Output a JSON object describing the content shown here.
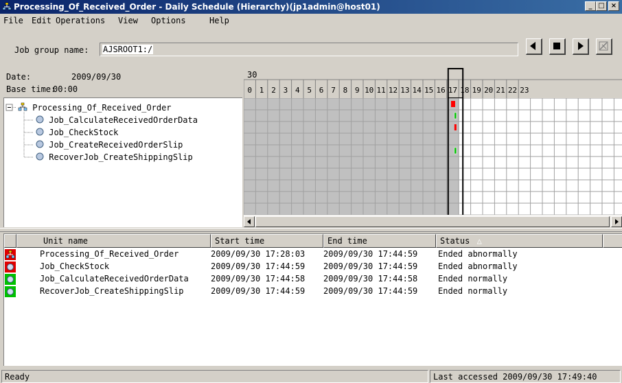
{
  "window": {
    "title": "Processing_Of_Received_Order - Daily Schedule (Hierarchy)(jp1admin@host01)",
    "caption_buttons": [
      "_",
      "□",
      "×"
    ]
  },
  "menu": [
    "File",
    "Edit",
    "Operations",
    "View",
    "Options",
    "Help"
  ],
  "toolbar": {
    "job_group_label": "Job group name:",
    "job_group_value": "AJSROOT1:/",
    "buttons": [
      "previous-icon",
      "stop-icon",
      "next-icon",
      "filter-icon"
    ]
  },
  "schedule_header": {
    "date_label": "Date:",
    "date_value": "2009/09/30",
    "base_time_label": "Base time:",
    "base_time_value": "00:00"
  },
  "tree": {
    "root": "Processing_Of_Received_Order",
    "children": [
      "Job_CalculateReceivedOrderData",
      "Job_CheckStock",
      "Job_CreateReceivedOrderSlip",
      "RecoverJob_CreateShippingSlip"
    ]
  },
  "gantt": {
    "day": "30",
    "hours": [
      "0",
      "1",
      "2",
      "3",
      "4",
      "5",
      "6",
      "7",
      "8",
      "9",
      "10",
      "11",
      "12",
      "13",
      "14",
      "15",
      "16",
      "17",
      "18",
      "19",
      "20",
      "21",
      "22",
      "23"
    ],
    "current_hour": 17,
    "bars": [
      {
        "row": 0,
        "status": "abnormal",
        "hour": 17.47
      },
      {
        "row": 1,
        "status": "normal",
        "hour": 17.75
      },
      {
        "row": 2,
        "status": "abnormal",
        "hour": 17.75
      },
      {
        "row": 4,
        "status": "normal",
        "hour": 17.75
      }
    ],
    "colors": {
      "abnormal": "#ff0000",
      "normal": "#00c000",
      "grid_bg": "#c0c0c0"
    }
  },
  "list": {
    "columns": [
      "Unit name",
      "Start time",
      "End time",
      "Status"
    ],
    "sort_indicator": "△",
    "rows": [
      {
        "icon": "jobnet-icon",
        "name": "Processing_Of_Received_Order",
        "start": "2009/09/30 17:28:03",
        "end": "2009/09/30 17:44:59",
        "status": "Ended abnormally"
      },
      {
        "icon": "job-abnormal-icon",
        "name": "Job_CheckStock",
        "start": "2009/09/30 17:44:59",
        "end": "2009/09/30 17:44:59",
        "status": "Ended abnormally"
      },
      {
        "icon": "job-normal-icon",
        "name": "Job_CalculateReceivedOrderData",
        "start": "2009/09/30 17:44:58",
        "end": "2009/09/30 17:44:58",
        "status": "Ended normally"
      },
      {
        "icon": "job-normal-icon",
        "name": "RecoverJob_CreateShippingSlip",
        "start": "2009/09/30 17:44:59",
        "end": "2009/09/30 17:44:59",
        "status": "Ended normally"
      }
    ]
  },
  "statusbar": {
    "left": "Ready",
    "right": "Last accessed 2009/09/30 17:49:40"
  }
}
